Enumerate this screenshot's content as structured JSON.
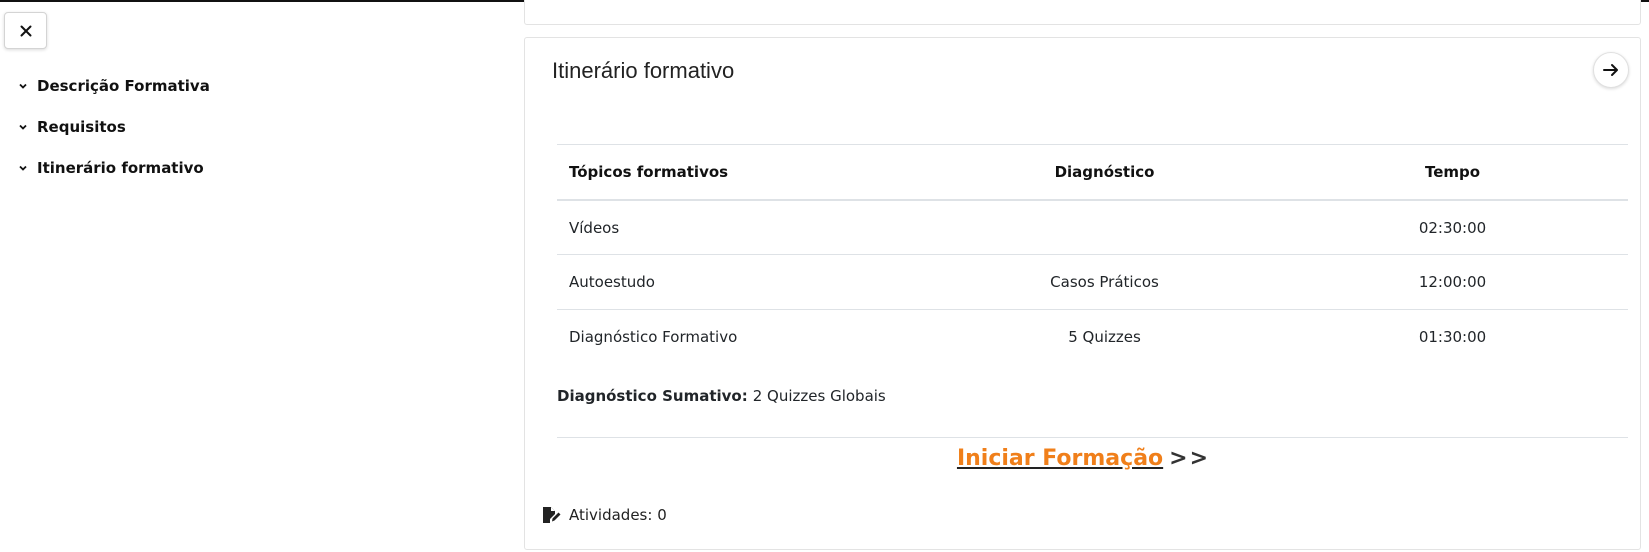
{
  "sidebar": {
    "close_icon": "close-icon",
    "items": [
      {
        "label": "Descrição Formativa",
        "icon": "chevron-down-icon"
      },
      {
        "label": "Requisitos",
        "icon": "chevron-down-icon"
      },
      {
        "label": "Itinerário formativo",
        "icon": "chevron-down-icon"
      }
    ]
  },
  "card": {
    "title": "Itinerário formativo",
    "nav_icon": "arrow-right-icon",
    "table": {
      "headers": [
        "Tópicos formativos",
        "Diagnóstico",
        "Tempo"
      ],
      "rows": [
        [
          "Vídeos",
          "",
          "02:30:00"
        ],
        [
          "Autoestudo",
          "Casos Práticos",
          "12:00:00"
        ],
        [
          "Diagnóstico Formativo",
          "5 Quizzes",
          "01:30:00"
        ]
      ]
    },
    "sumativo_label": "Diagnóstico Sumativo:",
    "sumativo_value": "2 Quizzes Globais",
    "start_link": "Iniciar Formação",
    "start_arrows": ">>",
    "atividades_label": "Atividades: 0",
    "atividades_icon": "file-edit-icon"
  },
  "colors": {
    "accent": "#f07f1a",
    "border": "#dee2e6"
  }
}
